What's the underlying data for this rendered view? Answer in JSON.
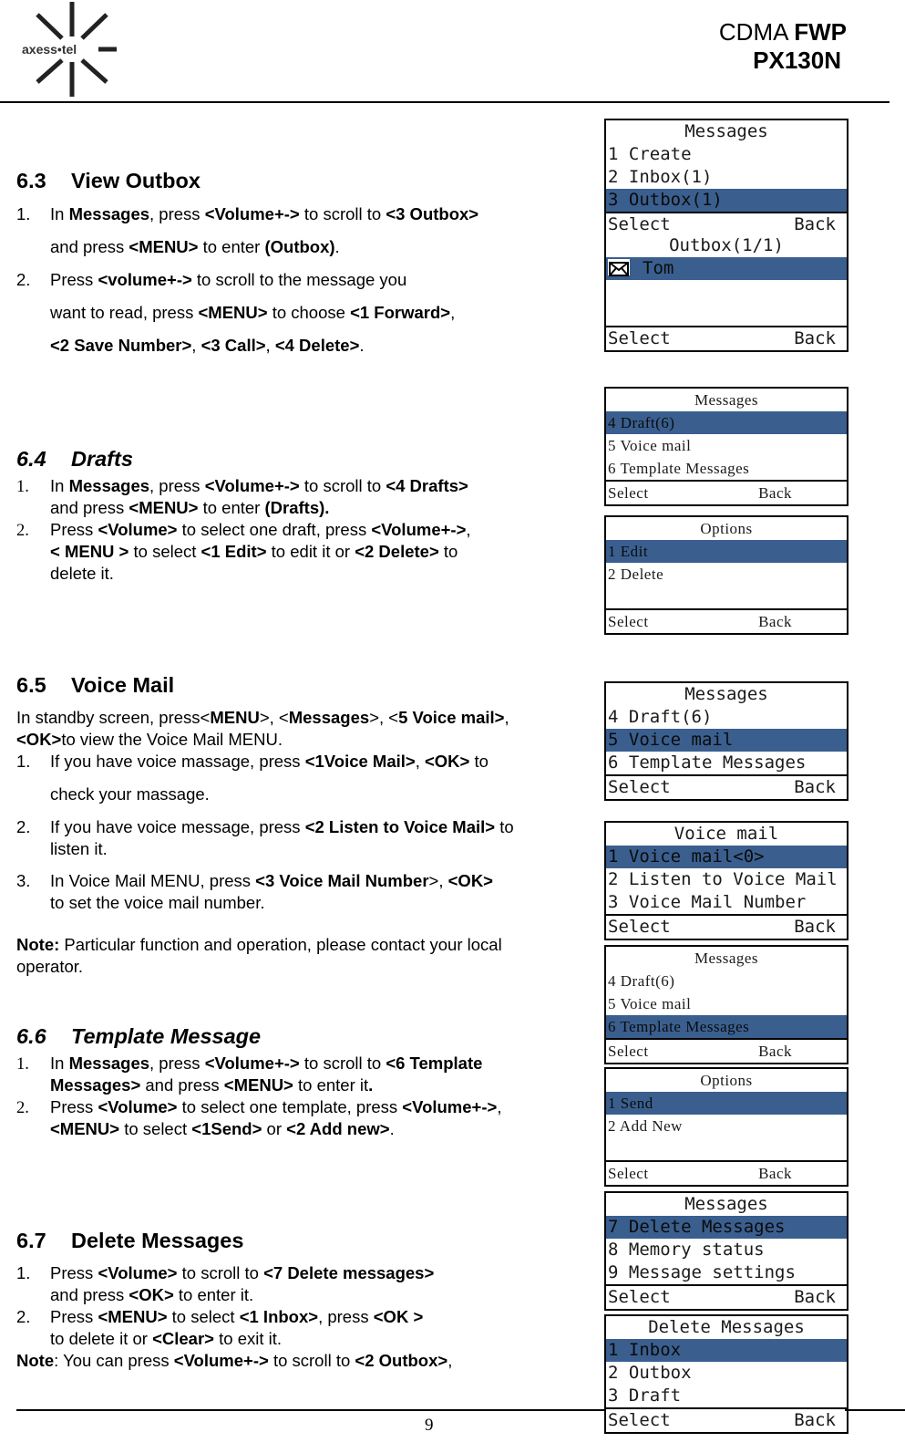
{
  "header": {
    "logo_text": "axess•tel",
    "title_line1_normal": "CDMA ",
    "title_line1_bold": "FWP",
    "title_line2": "PX130N"
  },
  "sections": {
    "s63": {
      "num": "6.3",
      "title": "View Outbox",
      "lines": [
        {
          "n": "1.",
          "parts": [
            [
              "In ",
              0
            ],
            [
              "Messages",
              1
            ],
            [
              ", press ",
              0
            ],
            [
              "<Volume+->",
              1
            ],
            [
              " to scroll to ",
              0
            ],
            [
              "<3 Outbox>",
              1
            ]
          ]
        },
        {
          "n": "",
          "parts": [
            [
              " and press ",
              0
            ],
            [
              "<MENU>",
              1
            ],
            [
              " to enter ",
              0
            ],
            [
              "(Outbox)",
              1
            ],
            [
              ".",
              0
            ]
          ]
        },
        {
          "n": "2.",
          "parts": [
            [
              "Press ",
              0
            ],
            [
              "<volume+->",
              1
            ],
            [
              " to scroll to the message you",
              0
            ]
          ]
        },
        {
          "n": "",
          "parts": [
            [
              "want to read, press ",
              0
            ],
            [
              "<MENU>",
              1
            ],
            [
              " to choose ",
              0
            ],
            [
              "<1 Forward>",
              1
            ],
            [
              ",",
              0
            ]
          ]
        },
        {
          "n": "",
          "parts": [
            [
              "<2 Save Number>",
              1
            ],
            [
              ", ",
              0
            ],
            [
              "<3 Call>",
              1
            ],
            [
              ", ",
              0
            ],
            [
              "<4 Delete>",
              1
            ],
            [
              ".",
              0
            ]
          ]
        }
      ]
    },
    "s64": {
      "num": "6.4",
      "title": "Drafts",
      "lines": [
        {
          "n": "1.",
          "parts": [
            [
              "In ",
              0
            ],
            [
              "Messages",
              1
            ],
            [
              ", press ",
              0
            ],
            [
              "<Volume+->",
              1
            ],
            [
              " to scroll to ",
              0
            ],
            [
              "<4 Drafts>",
              1
            ]
          ]
        },
        {
          "n": "",
          "parts": [
            [
              " and press ",
              0
            ],
            [
              "<MENU>",
              1
            ],
            [
              " to enter ",
              0
            ],
            [
              "(Drafts).",
              1
            ]
          ]
        },
        {
          "n": "2.",
          "parts": [
            [
              "Press ",
              0
            ],
            [
              "<Volume>",
              1
            ],
            [
              " to select one draft, press ",
              0
            ],
            [
              "<Volume+->",
              1
            ],
            [
              ",",
              0
            ]
          ]
        },
        {
          "n": "",
          "parts": [
            [
              "< MENU >",
              1
            ],
            [
              " to select ",
              0
            ],
            [
              "<1 Edit>",
              1
            ],
            [
              " to edit it or ",
              0
            ],
            [
              "<2 Delete>",
              1
            ],
            [
              " to",
              0
            ]
          ]
        },
        {
          "n": "",
          "parts": [
            [
              "delete it.",
              0
            ]
          ]
        }
      ]
    },
    "s65": {
      "num": "6.5",
      "title": "Voice Mail",
      "intro": [
        {
          "parts": [
            [
              "In standby screen, press<",
              0
            ],
            [
              "MENU",
              1
            ],
            [
              ">, <",
              0
            ],
            [
              "Messages",
              1
            ],
            [
              ">, <",
              0
            ],
            [
              "5 Voice mail>",
              1
            ],
            [
              ",",
              0
            ]
          ]
        },
        {
          "parts": [
            [
              "<OK>",
              1
            ],
            [
              "to view the Voice Mail MENU.",
              0
            ]
          ]
        }
      ],
      "lines": [
        {
          "n": "1.",
          "parts": [
            [
              "If you have voice massage, press ",
              0
            ],
            [
              "<1Voice Mail>",
              1
            ],
            [
              ", ",
              0
            ],
            [
              "<OK>",
              1
            ],
            [
              " to",
              0
            ]
          ]
        },
        {
          "n": "",
          "parts": [
            [
              "check your massage.",
              0
            ]
          ]
        },
        {
          "n": "2.",
          "parts": [
            [
              "If you have voice message, press ",
              0
            ],
            [
              "<2 Listen to Voice Mail>",
              1
            ],
            [
              " to",
              0
            ]
          ]
        },
        {
          "n": "",
          "parts": [
            [
              "listen it.",
              0
            ]
          ]
        },
        {
          "n": "3.",
          "parts": [
            [
              "In Voice Mail MENU, press ",
              0
            ],
            [
              "<3 Voice Mail Number",
              1
            ],
            [
              ">, ",
              0
            ],
            [
              "<OK>",
              1
            ]
          ]
        },
        {
          "n": "",
          "parts": [
            [
              "to set the voice mail number.",
              0
            ]
          ]
        }
      ],
      "note": [
        {
          "parts": [
            [
              "Note:",
              1
            ],
            [
              " Particular function and operation, please contact your local",
              0
            ]
          ]
        },
        {
          "parts": [
            [
              "operator.",
              0
            ]
          ]
        }
      ]
    },
    "s66": {
      "num": "6.6",
      "title": "Template Message",
      "lines": [
        {
          "n": "1.",
          "parts": [
            [
              "In ",
              0
            ],
            [
              "Messages",
              1
            ],
            [
              ", press ",
              0
            ],
            [
              "<Volume+->",
              1
            ],
            [
              " to scroll to ",
              0
            ],
            [
              "<6 Template",
              1
            ]
          ]
        },
        {
          "n": "",
          "parts": [
            [
              "Messages>",
              1
            ],
            [
              " and press ",
              0
            ],
            [
              "<MENU>",
              1
            ],
            [
              " to enter it",
              0
            ],
            [
              ".",
              1
            ]
          ]
        },
        {
          "n": "2.",
          "parts": [
            [
              "Press ",
              0
            ],
            [
              "<Volume>",
              1
            ],
            [
              " to select one template, press ",
              0
            ],
            [
              "<Volume+->",
              1
            ],
            [
              ",",
              0
            ]
          ]
        },
        {
          "n": "",
          "parts": [
            [
              " ",
              0
            ],
            [
              "<MENU>",
              1
            ],
            [
              " to select ",
              0
            ],
            [
              "<1Send>",
              1
            ],
            [
              " or ",
              0
            ],
            [
              "<2 Add new>",
              1
            ],
            [
              ".",
              0
            ]
          ]
        }
      ]
    },
    "s67": {
      "num": "6.7",
      "title": "Delete Messages",
      "lines": [
        {
          "n": "1.",
          "parts": [
            [
              "Press ",
              0
            ],
            [
              "<Volume>",
              1
            ],
            [
              " to scroll to ",
              0
            ],
            [
              "<7 Delete messages>",
              1
            ]
          ]
        },
        {
          "n": "",
          "parts": [
            [
              "and press ",
              0
            ],
            [
              "<OK>",
              1
            ],
            [
              " to enter it.",
              0
            ]
          ]
        },
        {
          "n": "2.",
          "parts": [
            [
              "Press ",
              0
            ],
            [
              "<MENU>",
              1
            ],
            [
              " to select ",
              0
            ],
            [
              "<1 Inbox>",
              1
            ],
            [
              ", press ",
              0
            ],
            [
              "<OK >",
              1
            ]
          ]
        },
        {
          "n": "",
          "parts": [
            [
              " to delete it or ",
              0
            ],
            [
              "<Clear>",
              1
            ],
            [
              " to exit it.",
              0
            ]
          ]
        }
      ],
      "note": {
        "parts": [
          [
            " Note",
            1
          ],
          [
            ": You can press ",
            0
          ],
          [
            "<Volume+->",
            1
          ],
          [
            " to scroll to ",
            0
          ],
          [
            "<2 Outbox>",
            1
          ],
          [
            ",",
            0
          ]
        ]
      }
    }
  },
  "screens": [
    {
      "title": "Messages",
      "items": [
        "1 Create",
        "2 Inbox(1)",
        "3 Outbox(1)"
      ],
      "selected": 2,
      "soft_left": "Select",
      "soft_right": "Back"
    },
    {
      "title": "Outbox(1/1)",
      "items": [
        "Tom",
        "",
        ""
      ],
      "selected": 0,
      "icon": "envelope-icon",
      "soft_left": "Select",
      "soft_right": "Back"
    },
    {
      "title": "Messages",
      "items": [
        "4 Draft(6)",
        "5 Voice mail",
        "6 Template Messages"
      ],
      "selected": 0,
      "soft_left": "Select",
      "soft_right": "Back"
    },
    {
      "title": "Options",
      "items": [
        "1 Edit",
        "2 Delete",
        ""
      ],
      "selected": 0,
      "soft_left": "Select",
      "soft_right": "Back"
    },
    {
      "title": "Messages",
      "items": [
        "4 Draft(6)",
        "5 Voice mail",
        "6 Template Messages"
      ],
      "selected": 1,
      "soft_left": "Select",
      "soft_right": "Back"
    },
    {
      "title": "Voice mail",
      "items": [
        "1 Voice mail<0>",
        "2 Listen to Voice Mail",
        "3 Voice Mail Number"
      ],
      "selected": 0,
      "soft_left": "Select",
      "soft_right": "Back"
    },
    {
      "title": "Messages",
      "items": [
        "4 Draft(6)",
        "5 Voice mail",
        "6 Template Messages"
      ],
      "selected": 2,
      "soft_left": "Select",
      "soft_right": "Back"
    },
    {
      "title": "Options",
      "items": [
        "1 Send",
        "2 Add New",
        ""
      ],
      "selected": 0,
      "soft_left": "Select",
      "soft_right": "Back"
    },
    {
      "title": "Messages",
      "items": [
        "7 Delete Messages",
        "8 Memory status",
        "9 Message settings"
      ],
      "selected": 0,
      "soft_left": "Select",
      "soft_right": "Back"
    },
    {
      "title": "Delete Messages",
      "items": [
        "1 Inbox",
        "2 Outbox",
        "3 Draft"
      ],
      "selected": 0,
      "soft_left": "Select",
      "soft_right": "Back"
    }
  ],
  "colors": {
    "highlight": "#3a5f8f"
  },
  "footer": {
    "page_number": "9"
  }
}
